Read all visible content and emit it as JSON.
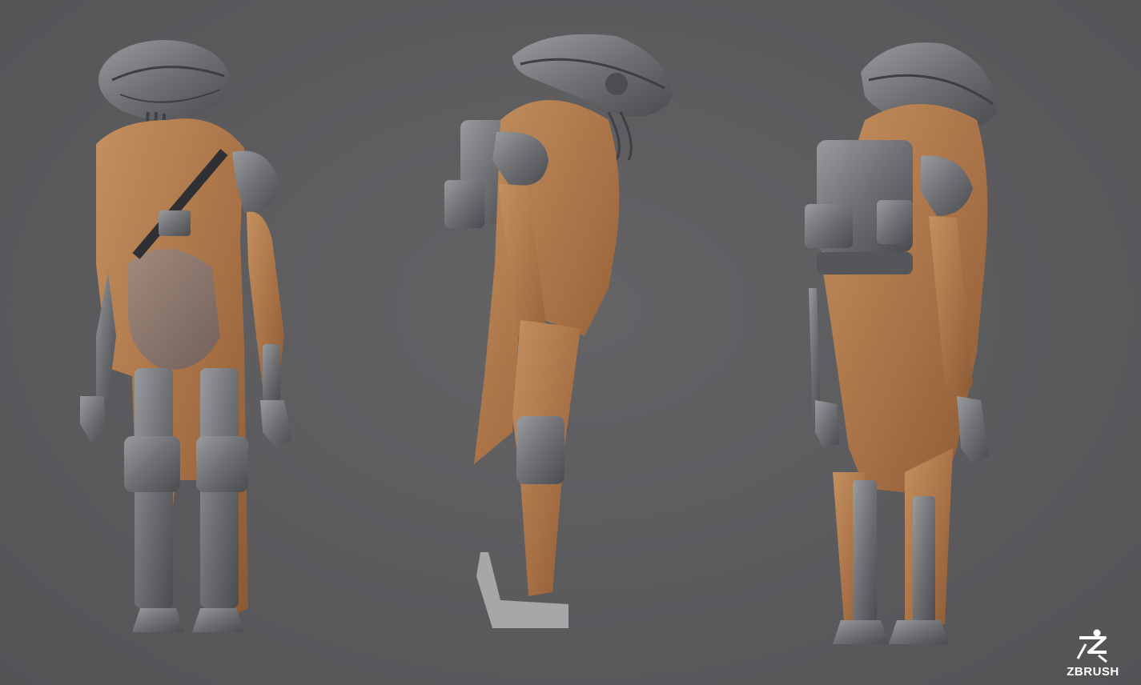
{
  "scene": {
    "background_color": "#5b5b5e",
    "views": [
      {
        "name": "front-view"
      },
      {
        "name": "side-view"
      },
      {
        "name": "back-view"
      }
    ],
    "materials": {
      "cloth": "#b07a4e",
      "metal": "#737476",
      "leather": "#8c7466"
    }
  },
  "logo": {
    "text": "ZBRUSH",
    "icon": "zbrush-logo-icon"
  }
}
